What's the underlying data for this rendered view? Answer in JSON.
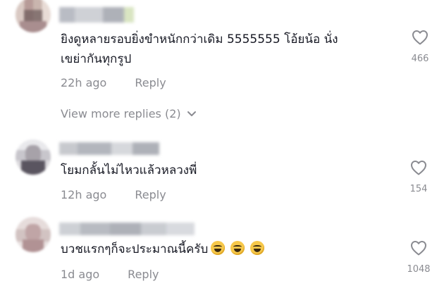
{
  "comments": [
    {
      "text_line1": "ยิงดูหลายรอบยิ่งขำหนักกว่าเดิม 5555555 โอ้ยน้อ นั่ง",
      "text_line2": "เขย่ากันทุกรูป",
      "time": "22h ago",
      "reply_label": "Reply",
      "likes": "466"
    },
    {
      "text_line1": "โยมกลั้นไม่ไหวแล้วหลวงพี่",
      "time": "12h ago",
      "reply_label": "Reply",
      "likes": "154"
    },
    {
      "text_line1": "บวชแรกๆก็จะประมาณนี้ครับ",
      "time": "1d ago",
      "reply_label": "Reply",
      "likes": "1048"
    }
  ],
  "view_more": {
    "label": "View more replies (2)"
  },
  "icons": {
    "like": "heart-outline-icon",
    "expand": "chevron-down-icon",
    "emoji": "grinning-sweat-emoji"
  },
  "colors": {
    "text": "#161823",
    "muted": "#8a8b91",
    "background": "#ffffff"
  }
}
